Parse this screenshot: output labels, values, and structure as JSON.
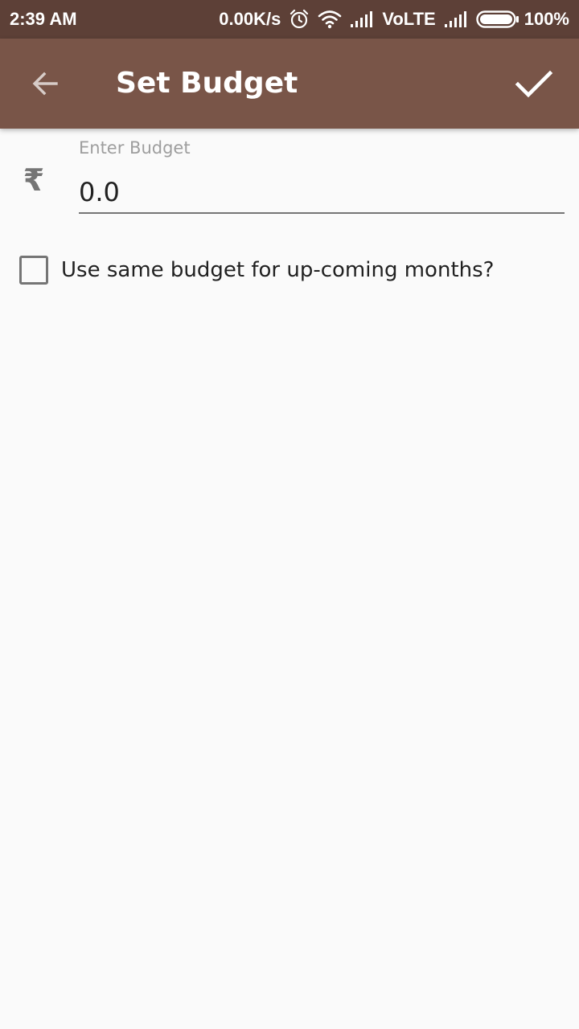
{
  "status_bar": {
    "time": "2:39 AM",
    "network_speed": "0.00K/s",
    "network_type": "VoLTE",
    "battery": "100%",
    "icons": [
      "alarm-icon",
      "wifi-icon",
      "signal-icon",
      "signal-icon",
      "battery-icon"
    ]
  },
  "app_bar": {
    "title": "Set Budget",
    "back_icon": "arrow-back-icon",
    "confirm_icon": "check-icon"
  },
  "form": {
    "currency_icon": "rupee-icon",
    "currency_symbol": "₹",
    "budget_label": "Enter Budget",
    "budget_value": "0.0",
    "repeat_checkbox": {
      "label": "Use same budget for up-coming months?",
      "checked": false
    }
  },
  "colors": {
    "status_bar": "#5d4037",
    "app_bar": "#795548",
    "background": "#fafafa",
    "text_primary": "#212121",
    "text_hint": "#9e9e9e",
    "icon_grey": "#757575"
  }
}
